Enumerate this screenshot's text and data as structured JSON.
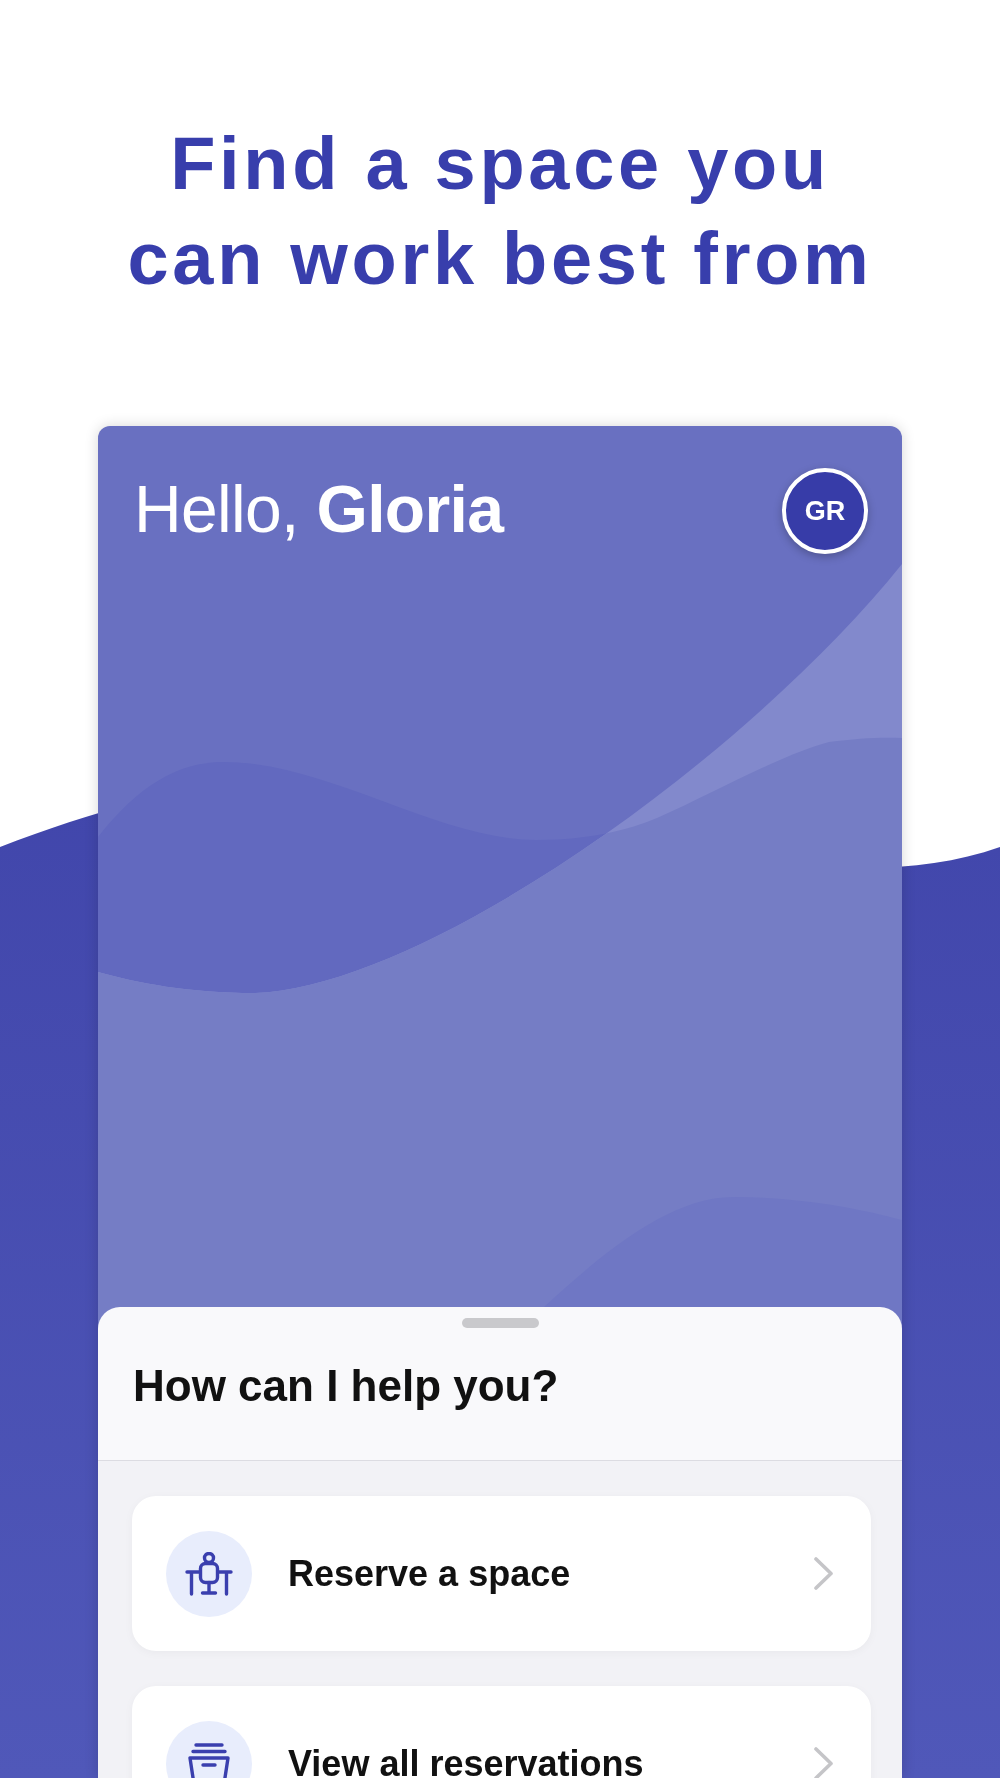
{
  "headline": {
    "title": "Find a space you can work best from"
  },
  "phone": {
    "greeting": "Hello, **Gloria**",
    "avatar": {
      "initials": "GR"
    },
    "sheet": {
      "title": "How can I help you?",
      "actions": [
        {
          "kind": "reserve",
          "label": "Reserve a space"
        },
        {
          "kind": "reservations",
          "label": "View all reservations"
        }
      ]
    }
  }
}
